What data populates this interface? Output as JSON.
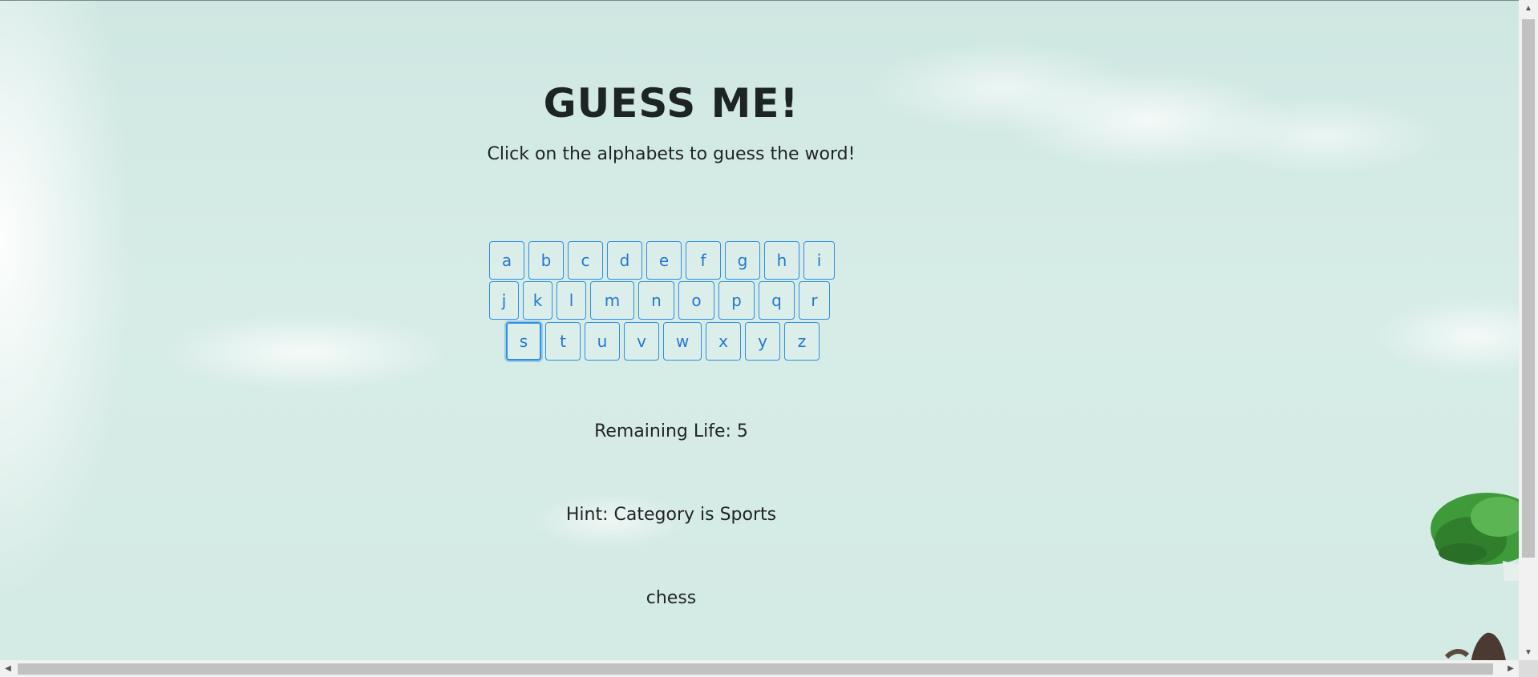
{
  "game": {
    "title": "GUESS ME!",
    "instructions": "Click on the alphabets to guess the word!",
    "keyboard_rows": [
      [
        "a",
        "b",
        "c",
        "d",
        "e",
        "f",
        "g",
        "h",
        "i"
      ],
      [
        "j",
        "k",
        "l",
        "m",
        "n",
        "o",
        "p",
        "q",
        "r"
      ],
      [
        "s",
        "t",
        "u",
        "v",
        "w",
        "x",
        "y",
        "z"
      ]
    ],
    "focused_key": "s",
    "remaining_life": "Remaining Life: 5",
    "hint": "Hint: Category is Sports",
    "word_display": "chess"
  },
  "colors": {
    "key_border": "#2f8ee6",
    "key_text": "#2478d0",
    "text": "#1f2424",
    "background": "#d4eae4"
  },
  "icons": {
    "scroll_up": "triangle-up-icon",
    "scroll_down": "triangle-down-icon",
    "scroll_left": "triangle-left-icon",
    "scroll_right": "triangle-right-icon"
  }
}
